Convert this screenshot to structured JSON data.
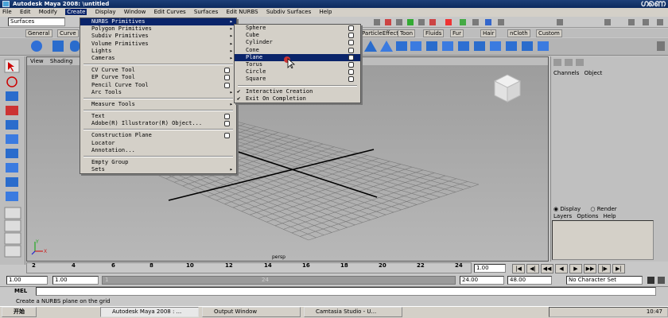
{
  "window": {
    "title": "Autodesk Maya 2008: \\untitled"
  },
  "watermark_text": "ഗണെ",
  "menubar": {
    "items": [
      "File",
      "Edit",
      "Modify",
      "Create",
      "Display",
      "Window",
      "Edit Curves",
      "Surfaces",
      "Edit NURBS",
      "Subdiv Surfaces",
      "Help"
    ]
  },
  "statusline": {
    "menu_set": "Surfaces"
  },
  "shelf": {
    "tabs": [
      "General",
      "Curve",
      "ParticleEffects",
      "Toon",
      "Fluids",
      "Fur",
      "Hair",
      "nCloth",
      "Custom"
    ]
  },
  "viewport": {
    "menu": [
      "View",
      "Shading"
    ],
    "camera_label": "persp",
    "axis_x": "X",
    "axis_y": "Y",
    "axis_z": "Z"
  },
  "channel_box": {
    "tabs": [
      "Channels",
      "Object"
    ]
  },
  "layer_editor": {
    "display": "Display",
    "render": "Render",
    "menu": [
      "Layers",
      "Options",
      "Help"
    ]
  },
  "timeline": {
    "ticks": [
      "2",
      "4",
      "6",
      "8",
      "10",
      "12",
      "14",
      "16",
      "18",
      "20",
      "22",
      "24"
    ],
    "current_frame": "1.00",
    "range_start": "1.00",
    "range_start2": "1.00",
    "range_inner_start": "1",
    "range_inner_end": "24",
    "range_end": "24.00",
    "range_end2": "48.00",
    "character_set": "No Character Set"
  },
  "cmdline": {
    "label": "MEL"
  },
  "helpline": {
    "text": "Create a NURBS plane on the grid"
  },
  "taskbar": {
    "start": "开始",
    "tasks": [
      "Autodesk Maya 2008 : ...",
      "Output Window",
      "Camtasia Studio - U..."
    ],
    "clock": "10:47"
  },
  "create_menu": {
    "items": [
      {
        "label": "NURBS Primitives",
        "arrow": "▸",
        "highlighted": true
      },
      {
        "label": "Polygon Primitives",
        "arrow": "▸"
      },
      {
        "label": "Subdiv Primitives",
        "arrow": "▸"
      },
      {
        "label": "Volume Primitives",
        "arrow": "▸"
      },
      {
        "label": "Lights",
        "arrow": "▸"
      },
      {
        "label": "Cameras",
        "arrow": "▸"
      },
      {
        "sep": true
      },
      {
        "label": "CV Curve Tool",
        "opt": true
      },
      {
        "label": "EP Curve Tool",
        "opt": true
      },
      {
        "label": "Pencil Curve Tool",
        "opt": true
      },
      {
        "label": "Arc Tools",
        "arrow": "▸"
      },
      {
        "sep": true
      },
      {
        "label": "Measure Tools",
        "arrow": "▸"
      },
      {
        "sep": true
      },
      {
        "label": "Text",
        "opt": true
      },
      {
        "label": "Adobe(R) Illustrator(R) Object...",
        "opt": true
      },
      {
        "sep": true
      },
      {
        "label": "Construction Plane",
        "opt": true
      },
      {
        "label": "Locator"
      },
      {
        "label": "Annotation..."
      },
      {
        "sep": true
      },
      {
        "label": "Empty Group"
      },
      {
        "label": "Sets",
        "arrow": "▸"
      }
    ]
  },
  "nurbs_submenu": {
    "items": [
      {
        "label": "Sphere",
        "opt": true
      },
      {
        "label": "Cube",
        "opt": true
      },
      {
        "label": "Cylinder",
        "opt": true
      },
      {
        "label": "Cone",
        "opt": true
      },
      {
        "label": "Plane",
        "opt": true,
        "highlighted": true
      },
      {
        "label": "Torus",
        "opt": true
      },
      {
        "label": "Circle",
        "opt": true
      },
      {
        "label": "Square",
        "opt": true
      },
      {
        "sep": true
      },
      {
        "label": "Interactive Creation",
        "checked": true
      },
      {
        "label": "Exit On Completion",
        "checked": true
      }
    ]
  },
  "colors": {
    "title_bar": "#0c2a5e",
    "menu_highlight": "#0a246a",
    "grid_line": "#7a7a7a"
  }
}
